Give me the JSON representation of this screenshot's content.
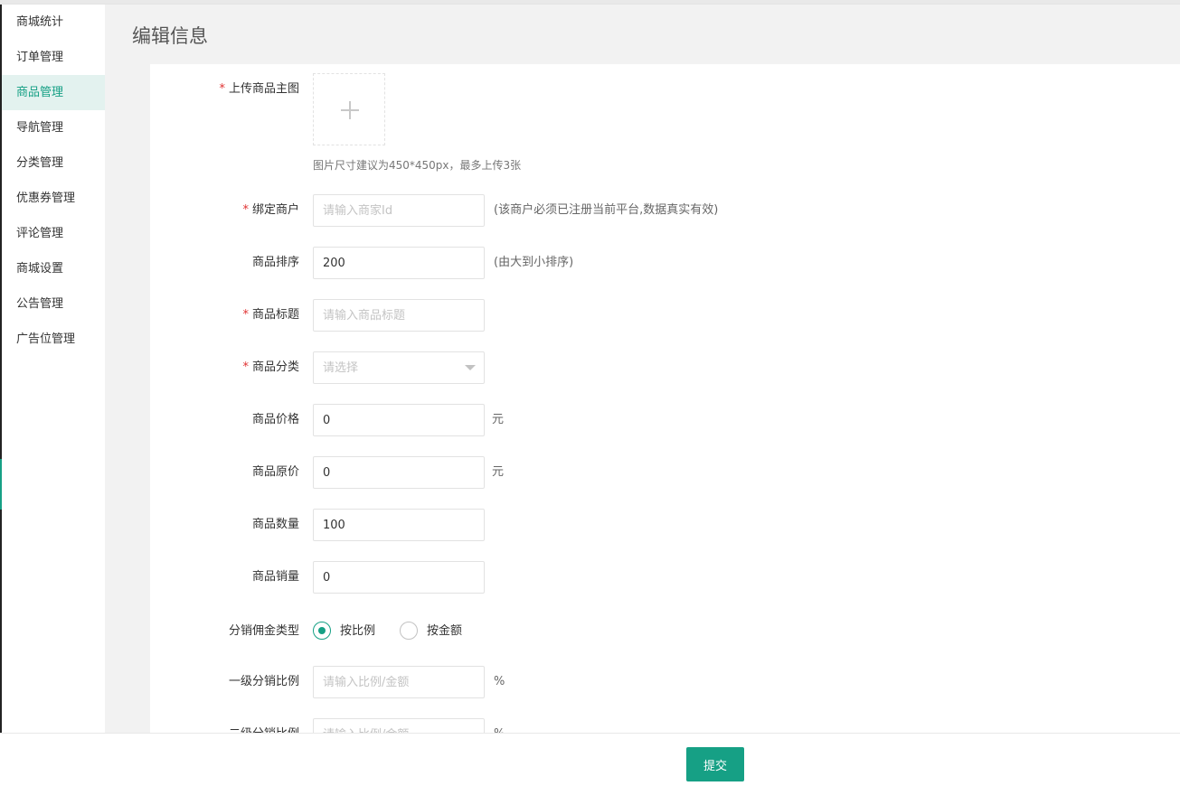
{
  "sidebar": {
    "items": [
      {
        "label": "商城统计"
      },
      {
        "label": "订单管理"
      },
      {
        "label": "商品管理"
      },
      {
        "label": "导航管理"
      },
      {
        "label": "分类管理"
      },
      {
        "label": "优惠券管理"
      },
      {
        "label": "评论管理"
      },
      {
        "label": "商城设置"
      },
      {
        "label": "公告管理"
      },
      {
        "label": "广告位管理"
      }
    ],
    "active_index": 2
  },
  "page": {
    "title": "编辑信息"
  },
  "form": {
    "required_mark": "*",
    "upload": {
      "label": "上传商品主图",
      "hint": "图片尺寸建议为450*450px，最多上传3张"
    },
    "merchant": {
      "label": "绑定商户",
      "placeholder": "请输入商家Id",
      "value": "",
      "note": "(该商户必须已注册当前平台,数据真实有效)"
    },
    "sort": {
      "label": "商品排序",
      "value": "200",
      "note": "(由大到小排序)"
    },
    "title": {
      "label": "商品标题",
      "placeholder": "请输入商品标题",
      "value": ""
    },
    "category": {
      "label": "商品分类",
      "placeholder": "请选择",
      "value": ""
    },
    "price": {
      "label": "商品价格",
      "value": "0",
      "unit": "元"
    },
    "original_price": {
      "label": "商品原价",
      "value": "0",
      "unit": "元"
    },
    "quantity": {
      "label": "商品数量",
      "value": "100"
    },
    "sales": {
      "label": "商品销量",
      "value": "0"
    },
    "commission_type": {
      "label": "分销佣金类型",
      "options": [
        "按比例",
        "按金额"
      ],
      "selected": "按比例"
    },
    "level1": {
      "label": "一级分销比例",
      "placeholder": "请输入比例/金额",
      "value": "",
      "unit": "%"
    },
    "level2": {
      "label": "二级分销比例",
      "placeholder": "请输入比例/金额",
      "value": "",
      "unit": "%"
    }
  },
  "footer": {
    "submit_label": "提交"
  },
  "colors": {
    "accent": "#16a085",
    "required": "#e03131",
    "content_bg": "#f2f2f2",
    "active_item_bg": "#e3f2ef"
  },
  "icons": {
    "upload": "plus-icon",
    "select": "caret-down-icon"
  }
}
